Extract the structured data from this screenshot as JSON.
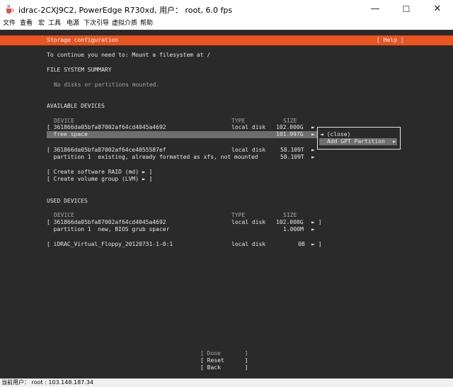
{
  "window": {
    "title": "idrac-2CXJ9C2, PowerEdge R730xd, 用户： root, 6.0 fps",
    "minimize": "—",
    "maximize": "☐",
    "close": "✕",
    "icon": "java-cup-icon"
  },
  "menu": [
    "文件",
    "查看",
    "宏",
    "工具",
    "电源",
    "下次引导",
    "虚拟介质",
    "帮助"
  ],
  "installer": {
    "header_title": "Storage configuration",
    "help": "[ Help ]",
    "instruction": "To continue you need to: Mount a filesystem at /",
    "fs_summary": {
      "heading": "FILE SYSTEM SUMMARY",
      "empty_text": "No disks or partitions mounted."
    },
    "available": {
      "heading": "AVAILABLE DEVICES",
      "col_device": "DEVICE",
      "col_type": "TYPE",
      "col_size": "SIZE",
      "rows": [
        {
          "device": "[ 361866da05bfa87002af64cd4045a4692",
          "type": "local disk",
          "size": "102.000G",
          "arrow": "►"
        },
        {
          "device": "  free space",
          "type": "",
          "size": "101.997G",
          "arrow": "►"
        },
        {
          "device": "[ 361866da05bfa87002af64ce4055587ef",
          "type": "local disk",
          "size": "58.109T",
          "arrow": "►"
        },
        {
          "device": "  partition 1  existing, already formatted as xfs, not mounted",
          "type": "",
          "size": "58.109T",
          "arrow": "►"
        }
      ],
      "actions": [
        "[ Create software RAID (md) ► ]",
        "[ Create volume group (LVM) ► ]"
      ]
    },
    "popup": {
      "close": "◄ (close)",
      "add_partition": "Add GPT Partition",
      "add_arrow": "►"
    },
    "used": {
      "heading": "USED DEVICES",
      "col_device": "DEVICE",
      "col_type": "TYPE",
      "col_size": "SIZE",
      "rows": [
        {
          "device": "[ 361866da05bfa87002af64cd4045a4692",
          "type": "local disk",
          "size": "102.000G",
          "arrow": "► ]"
        },
        {
          "device": "  partition 1  new, BIOS grub spacer",
          "type": "",
          "size": "1.000M",
          "arrow": "►"
        },
        {
          "device": "[ iDRAC_Virtual_Floppy_20120731-1-0:1",
          "type": "local disk",
          "size": "0B",
          "arrow": "► ]"
        }
      ]
    },
    "buttons": {
      "done": "[ Done       ]",
      "reset": "[ Reset      ]",
      "back": "[ Back       ]"
    }
  },
  "statusbar": {
    "text": "当前用户： root : 103.148.187.34"
  },
  "colors": {
    "terminal_bg": "#2a2a2a",
    "header_orange": "#e95420",
    "selection": "#6e6e6e",
    "text": "#e6e6e6"
  }
}
